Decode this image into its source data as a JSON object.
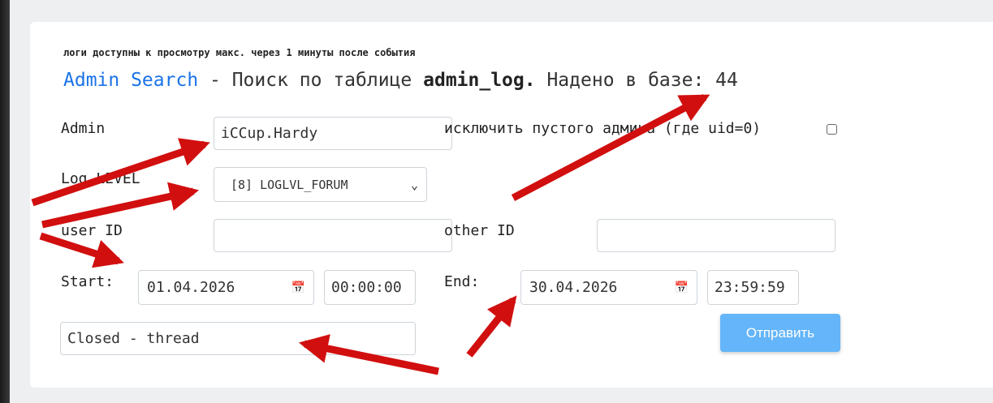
{
  "note": "логи доступны к просмотру макс. через 1 минуты после события",
  "title": {
    "link": "Admin Search",
    "middle": " - Поиск по таблице ",
    "table": "admin_log.",
    "found_label": " Надено в базе: ",
    "count": "44"
  },
  "form": {
    "admin_label": "Admin",
    "admin_value": "iCCup.Hardy",
    "exclude_label": "исключить пустого админа (где uid=0)",
    "exclude_checked": false,
    "loglevel_label": "Log LEVEL",
    "loglevel_value": "[8] LOGLVL_FORUM",
    "userid_label": "user ID",
    "userid_value": "",
    "otherid_label": "other ID",
    "otherid_value": "",
    "start_label": "Start:",
    "start_date": "01.04.2026",
    "start_time": "00:00:00",
    "end_label": "End:",
    "end_date": "30.04.2026",
    "end_time": "23:59:59",
    "text_value": "Closed - thread",
    "submit_label": "Отправить"
  },
  "icons": {
    "select": "chevron-down-icon",
    "date": "calendar-icon"
  },
  "colors": {
    "link": "#1a73e8",
    "button": "#64b5f9",
    "arrow": "#d10f0f"
  }
}
